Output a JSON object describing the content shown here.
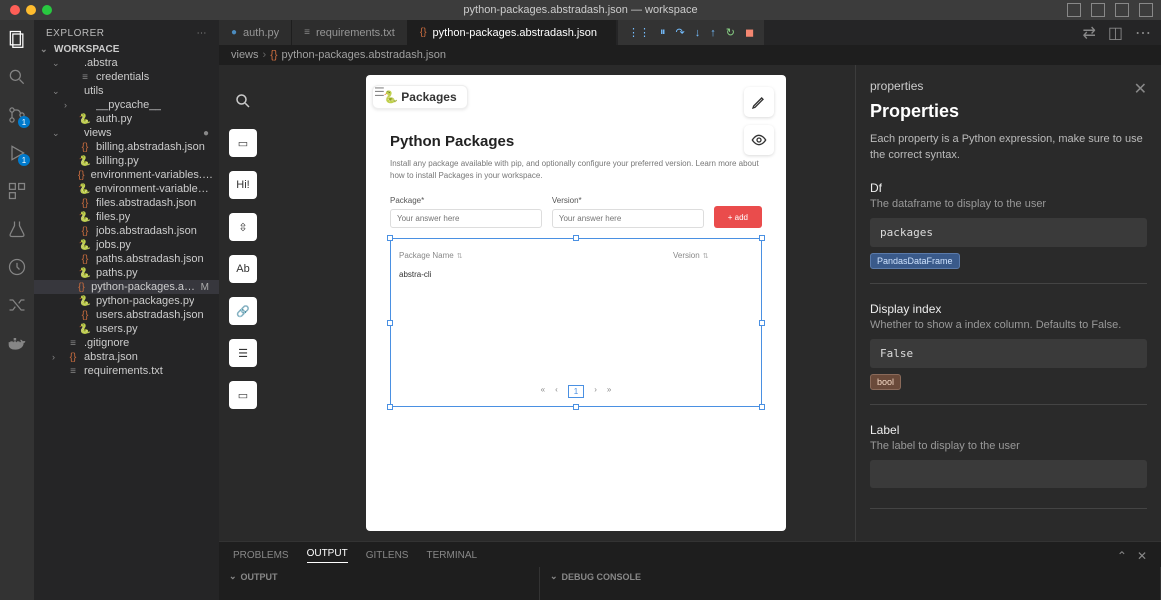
{
  "titlebar": {
    "title": "python-packages.abstradash.json — workspace"
  },
  "sidebar": {
    "title": "EXPLORER",
    "workspace": "WORKSPACE",
    "tree": [
      {
        "name": ".abstra",
        "type": "folder",
        "indent": 1,
        "open": true
      },
      {
        "name": "credentials",
        "type": "txt",
        "indent": 2
      },
      {
        "name": "utils",
        "type": "folder",
        "indent": 1,
        "open": true
      },
      {
        "name": "__pycache__",
        "type": "folder",
        "indent": 2,
        "open": false
      },
      {
        "name": "auth.py",
        "type": "py",
        "indent": 2
      },
      {
        "name": "views",
        "type": "folder",
        "indent": 1,
        "open": true,
        "dot": true
      },
      {
        "name": "billing.abstradash.json",
        "type": "json",
        "indent": 2
      },
      {
        "name": "billing.py",
        "type": "py",
        "indent": 2
      },
      {
        "name": "environment-variables.abstrad...",
        "type": "json",
        "indent": 2
      },
      {
        "name": "environment-variables.py",
        "type": "py",
        "indent": 2
      },
      {
        "name": "files.abstradash.json",
        "type": "json",
        "indent": 2
      },
      {
        "name": "files.py",
        "type": "py",
        "indent": 2
      },
      {
        "name": "jobs.abstradash.json",
        "type": "json",
        "indent": 2
      },
      {
        "name": "jobs.py",
        "type": "py",
        "indent": 2
      },
      {
        "name": "paths.abstradash.json",
        "type": "json",
        "indent": 2
      },
      {
        "name": "paths.py",
        "type": "py",
        "indent": 2
      },
      {
        "name": "python-packages.abstrad...",
        "type": "json",
        "indent": 2,
        "selected": true,
        "tag": "M"
      },
      {
        "name": "python-packages.py",
        "type": "py",
        "indent": 2
      },
      {
        "name": "users.abstradash.json",
        "type": "json",
        "indent": 2
      },
      {
        "name": "users.py",
        "type": "py",
        "indent": 2
      },
      {
        "name": ".gitignore",
        "type": "txt",
        "indent": 1
      },
      {
        "name": "abstra.json",
        "type": "json",
        "indent": 1,
        "chev": true
      },
      {
        "name": "requirements.txt",
        "type": "txt",
        "indent": 1
      }
    ]
  },
  "tabs": [
    {
      "label": "auth.py",
      "icon": "py"
    },
    {
      "label": "requirements.txt",
      "icon": "txt"
    },
    {
      "label": "python-packages.abstradash.json",
      "icon": "json",
      "active": true
    }
  ],
  "breadcrumb": {
    "part1": "views",
    "part2": "python-packages.abstradash.json"
  },
  "palette": {
    "search": "🔍",
    "items": [
      "▭",
      "Hi!",
      "⇳",
      "Ab",
      "🔗",
      "☰",
      "▭"
    ]
  },
  "canvas": {
    "badge": "🐍 Packages",
    "title": "Python Packages",
    "desc": "Install any package available with pip, and optionally configure your preferred version. Learn more about how to install Packages in your workspace.",
    "field1_label": "Package*",
    "field1_placeholder": "Your answer here",
    "field2_label": "Version*",
    "field2_placeholder": "Your answer here",
    "add_btn": "+ add",
    "table": {
      "col1": "Package Name",
      "col2": "Version",
      "rows": [
        {
          "name": "abstra-cli",
          "version": ""
        }
      ]
    },
    "pagination": [
      "«",
      "‹",
      "1",
      "›",
      "»"
    ]
  },
  "props": {
    "small_title": "properties",
    "big_title": "Properties",
    "intro": "Each property is a Python expression, make sure to use the correct syntax.",
    "items": [
      {
        "name": "Df",
        "desc": "The dataframe to display to the user",
        "code": "packages",
        "type": "PandasDataFrame",
        "badge_class": ""
      },
      {
        "name": "Display index",
        "desc": "Whether to show a index column. Defaults to False.",
        "code": "False",
        "type": "bool",
        "badge_class": "bool"
      },
      {
        "name": "Label",
        "desc": "The label to display to the user",
        "code": "",
        "type": "",
        "badge_class": ""
      }
    ]
  },
  "terminal": {
    "tabs": [
      "PROBLEMS",
      "OUTPUT",
      "GITLENS",
      "TERMINAL"
    ],
    "active": "OUTPUT",
    "col1": "OUTPUT",
    "col2": "DEBUG CONSOLE"
  },
  "activity_badge": "1"
}
